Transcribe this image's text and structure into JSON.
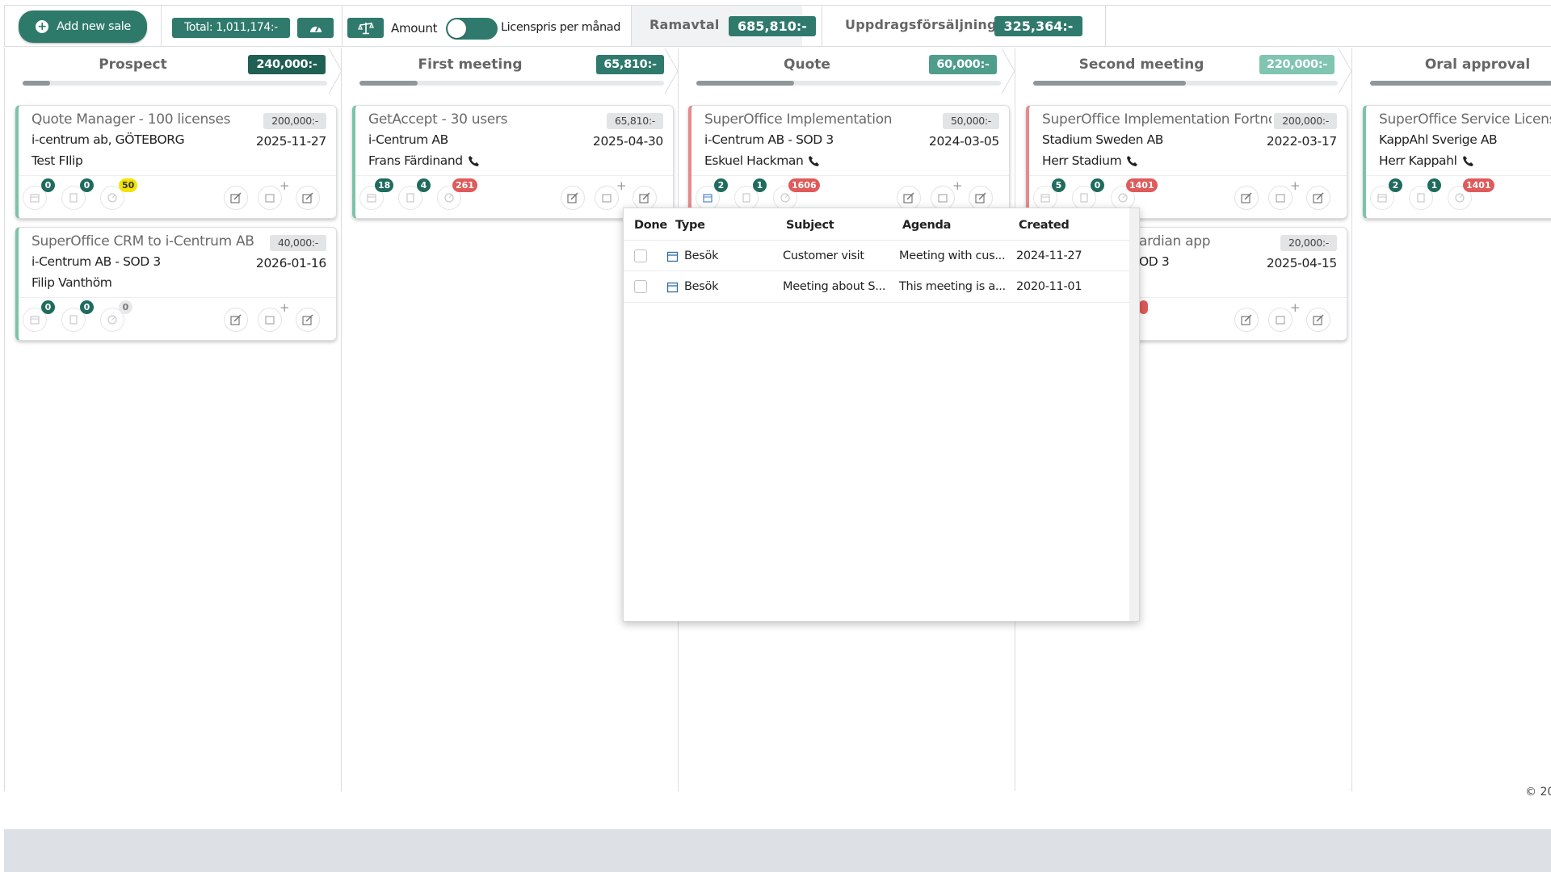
{
  "toolbar": {
    "add_new_sale": "Add new sale",
    "total": "Total: 1,011,174:-",
    "amount_label": "Amount",
    "licenspris_label": "Licenspris per månad",
    "tabs": [
      {
        "label": "Ramavtal",
        "value": "685,810:-"
      },
      {
        "label": "Uppdragsförsäljning",
        "value": "325,364:-"
      }
    ]
  },
  "columns": [
    {
      "title": "Prospect",
      "amount": "240,000:-",
      "progress": 0.09,
      "badge_color": "#1f5f54"
    },
    {
      "title": "First meeting",
      "amount": "65,810:-",
      "progress": 0.19,
      "badge_color": "#2f7a6c"
    },
    {
      "title": "Quote",
      "amount": "60,000:-",
      "progress": 0.32,
      "badge_color": "#4f9d8b"
    },
    {
      "title": "Second meeting",
      "amount": "220,000:-",
      "progress": 0.5,
      "badge_color": "#7fc5b0"
    },
    {
      "title": "Oral approval",
      "amount": "",
      "progress": 0.6,
      "badge_color": "#7fc5b0"
    }
  ],
  "cards": [
    {
      "title": "Quote Manager - 100 licenses",
      "amount": "200,000:-",
      "company": "i-centrum ab, GÖTEBORG",
      "date": "2025-11-27",
      "person": "Test FIlip",
      "phone": false,
      "counts": [
        "0",
        "0",
        "50"
      ]
    },
    {
      "title": "SuperOffice CRM to i-Centrum AB",
      "amount": "40,000:-",
      "company": "i-Centrum AB - SOD 3",
      "date": "2026-01-16",
      "person": "Filip Vanthöm",
      "phone": false,
      "counts": [
        "0",
        "0",
        "0"
      ]
    },
    {
      "title": "GetAccept - 30 users",
      "amount": "65,810:-",
      "company": "i-Centrum AB",
      "date": "2025-04-30",
      "person": "Frans Färdinand",
      "phone": true,
      "counts": [
        "18",
        "4",
        "261"
      ]
    },
    {
      "title": "SuperOffice Implementation",
      "amount": "50,000:-",
      "company": "i-Centrum AB - SOD 3",
      "date": "2024-03-05",
      "person": "Eskuel Hackman",
      "phone": true,
      "counts": [
        "2",
        "1",
        "1606"
      ]
    },
    {
      "title": "SuperOffice Implementation Fortnox",
      "amount": "200,000:-",
      "company": "Stadium Sweden AB",
      "date": "2022-03-17",
      "person": "Herr Stadium",
      "phone": true,
      "counts": [
        "5",
        "0",
        "1401"
      ]
    },
    {
      "title": "ardian app",
      "amount": "20,000:-",
      "company": "OD 3",
      "date": "2025-04-15",
      "person": "",
      "phone": false,
      "counts": [
        "",
        "",
        ""
      ]
    },
    {
      "title": "SuperOffice Service License",
      "amount": "",
      "company": "KappAhl Sverige AB",
      "date": "",
      "person": "Herr Kappahl",
      "phone": true,
      "counts": [
        "2",
        "1",
        "1401"
      ]
    }
  ],
  "popup": {
    "headers": [
      "Done",
      "Type",
      "Subject",
      "Agenda",
      "Created"
    ],
    "rows": [
      {
        "type": "Besök",
        "subject": "Customer visit",
        "agenda": "Meeting with cus...",
        "created": "2024-11-27"
      },
      {
        "type": "Besök",
        "subject": "Meeting about S...",
        "agenda": "This meeting is a...",
        "created": "2020-11-01"
      }
    ]
  },
  "footer": {
    "copyright": "© 20"
  }
}
